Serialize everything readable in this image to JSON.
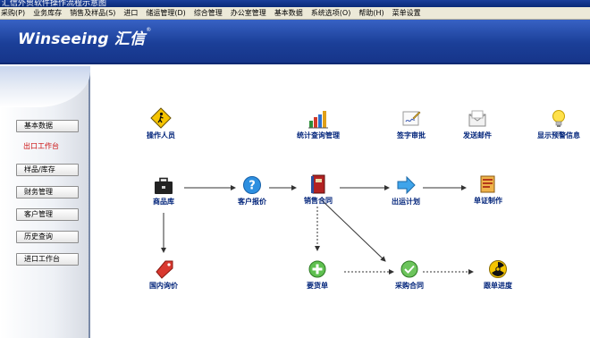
{
  "window": {
    "title": "汇信外贸软件操作流程示意图"
  },
  "menu": [
    "采购(P)",
    "业务库存",
    "销售及样品(S)",
    "进口",
    "储运管理(D)",
    "综合管理",
    "办公室管理",
    "基本数据",
    "系统选项(O)",
    "帮助(H)",
    "菜单设置"
  ],
  "brand": {
    "logo_text": "Winseeing 汇信",
    "reg_mark": "®"
  },
  "sidebar": {
    "items": [
      {
        "label": "基本数据",
        "active": false
      },
      {
        "label": "出口工作台",
        "active": true
      },
      {
        "label": "样品/库存",
        "active": false
      },
      {
        "label": "财务管理",
        "active": false
      },
      {
        "label": "客户管理",
        "active": false
      },
      {
        "label": "历史查询",
        "active": false
      },
      {
        "label": "进口工作台",
        "active": false
      }
    ]
  },
  "top_icons": [
    {
      "label": "操作人员",
      "icon": "operator-warning-sign-icon"
    },
    {
      "label": "统计查询管理",
      "icon": "bar-chart-icon"
    },
    {
      "label": "签字审批",
      "icon": "signature-pen-icon"
    },
    {
      "label": "发送邮件",
      "icon": "mail-envelope-icon"
    },
    {
      "label": "显示预警信息",
      "icon": "lightbulb-icon"
    }
  ],
  "flow": {
    "product_library": {
      "label": "商品库",
      "icon": "briefcase-icon"
    },
    "customer_quote": {
      "label": "客户报价",
      "icon": "help-question-icon"
    },
    "sales_contract": {
      "label": "销售合同",
      "icon": "book-icon"
    },
    "shipping_plan": {
      "label": "出运计划",
      "icon": "arrow-right-icon"
    },
    "document_making": {
      "label": "单证制作",
      "icon": "document-folder-icon"
    },
    "domestic_inquiry": {
      "label": "国内询价",
      "icon": "price-tag-icon"
    },
    "purchase_request": {
      "label": "要货单",
      "icon": "plus-circle-icon"
    },
    "purchase_contract": {
      "label": "采购合同",
      "icon": "check-circle-icon"
    },
    "order_tracking": {
      "label": "跟单进度",
      "icon": "radiation-icon"
    }
  },
  "colors": {
    "banner": "#1b3f98",
    "label_blue": "#00237a",
    "active_red": "#cc1111"
  }
}
